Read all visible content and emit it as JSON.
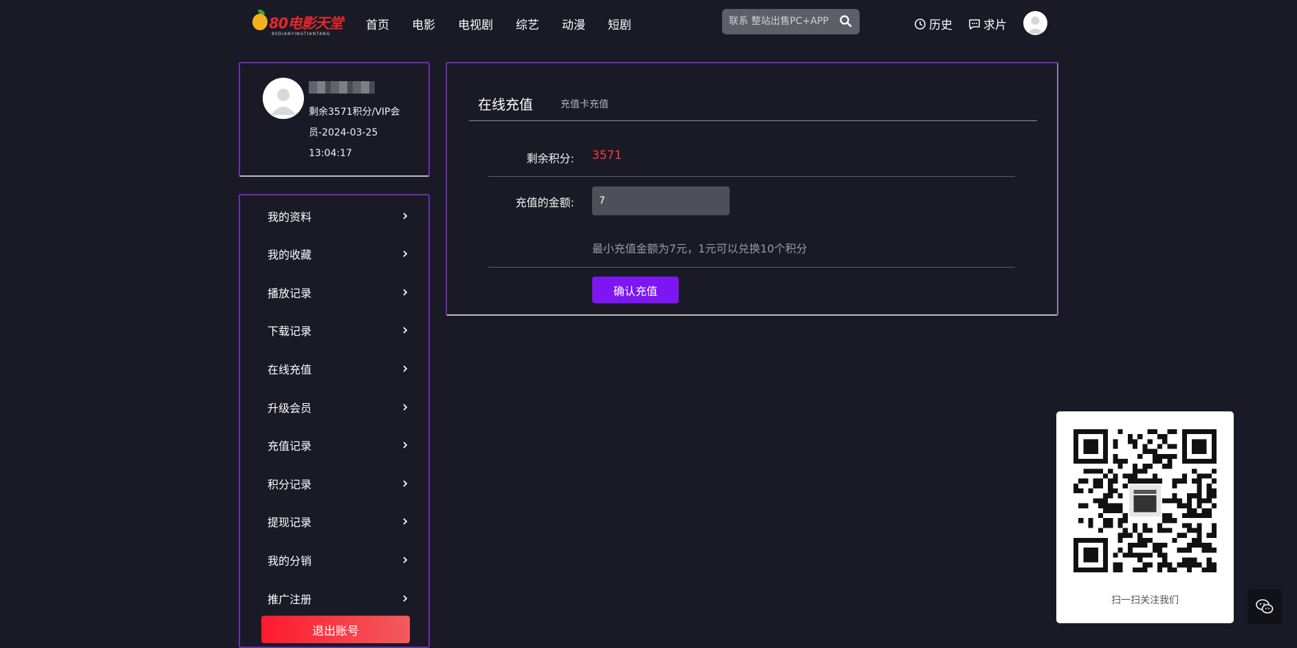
{
  "header": {
    "logo_text": "80电影天堂",
    "logo_subtext": "80DIANYINGTIANTANG",
    "nav": [
      "首页",
      "电影",
      "电视剧",
      "综艺",
      "动漫",
      "短剧"
    ],
    "search": {
      "placeholder": "联系 整站出售PC+APP"
    },
    "history_label": "历史",
    "request_label": "求片"
  },
  "profile": {
    "info": "剩余3571积分/VIP会员-2024-03-25 13:04:17"
  },
  "sidebar": {
    "items": [
      {
        "label": "我的资料"
      },
      {
        "label": "我的收藏"
      },
      {
        "label": "播放记录"
      },
      {
        "label": "下载记录"
      },
      {
        "label": "在线充值"
      },
      {
        "label": "升级会员"
      },
      {
        "label": "充值记录"
      },
      {
        "label": "积分记录"
      },
      {
        "label": "提现记录"
      },
      {
        "label": "我的分销"
      },
      {
        "label": "推广注册"
      }
    ],
    "logout_label": "退出账号"
  },
  "recharge": {
    "tabs": [
      "在线充值",
      "充值卡充值"
    ],
    "points_label": "剩余积分:",
    "points_value": "3571",
    "amount_label": "充值的金额:",
    "amount_value": "7",
    "hint": "最小充值金额为7元，1元可以兑换10个积分",
    "confirm_label": "确认充值"
  },
  "qr_panel": {
    "caption": "扫一扫关注我们"
  },
  "colors": {
    "background": "#191a25",
    "accent_purple": "#7d16f2",
    "border_purple": "#6a2fb0",
    "points_red": "#ff3a3a",
    "logout_red": "#ff1a2e"
  }
}
